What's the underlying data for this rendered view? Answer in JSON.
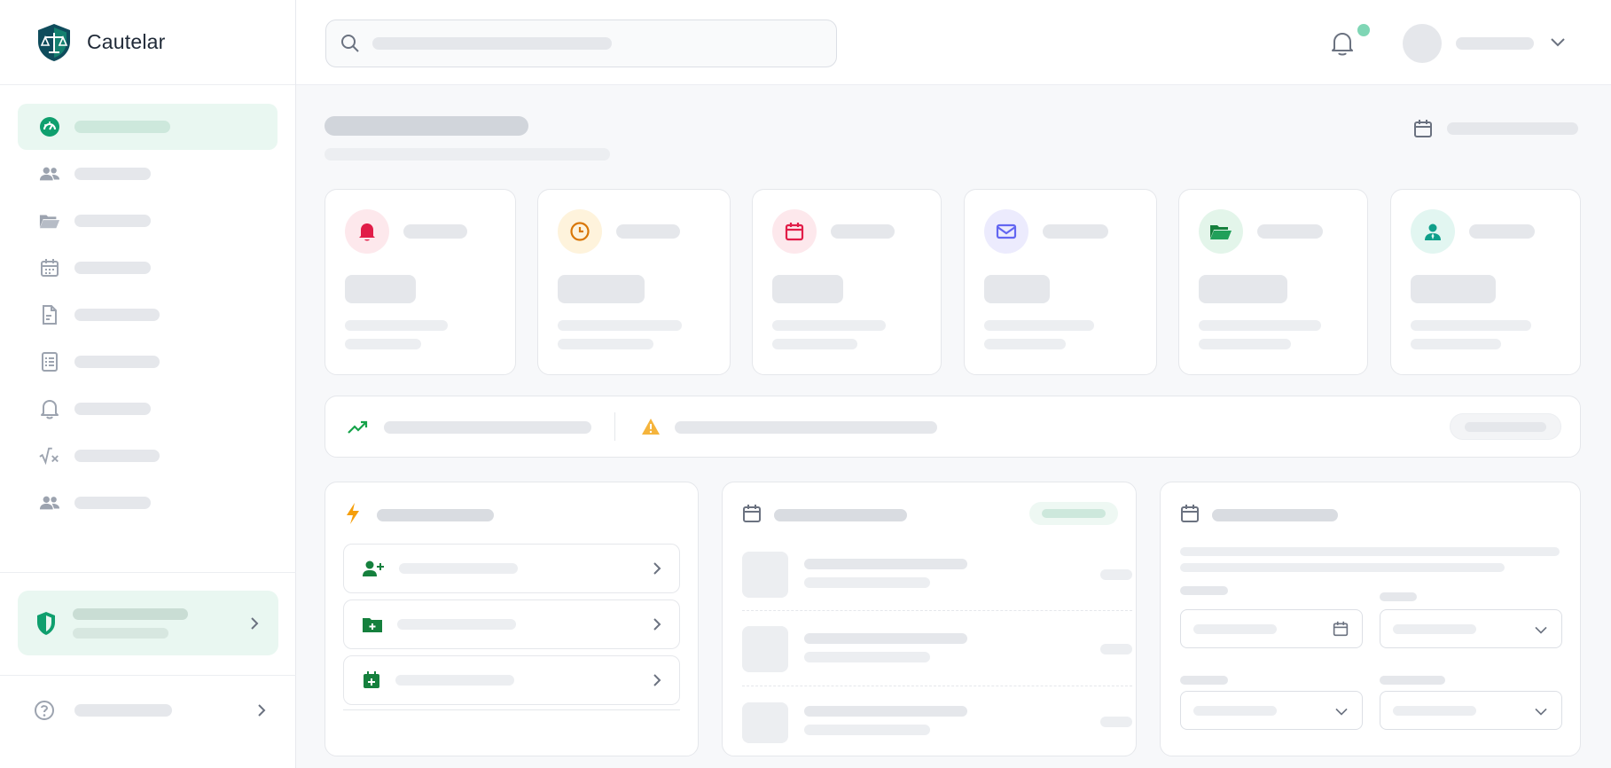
{
  "app": {
    "name": "Cautelar"
  },
  "colors": {
    "brand_green": "#16a34a",
    "active_bg": "#e9f7f1",
    "notification_dot": "#7fd6b5",
    "card_red_bg": "#fde8ec",
    "card_orange_bg": "#fef3dc",
    "card_purple_bg": "#ecebfd",
    "card_green_bg": "#e3f5ea",
    "card_teal_bg": "#e2f6f1"
  },
  "sidebar": {
    "items": [
      {
        "icon": "dashboard-gauge-icon",
        "active": true
      },
      {
        "icon": "users-icon"
      },
      {
        "icon": "folder-open-icon"
      },
      {
        "icon": "calendar-icon"
      },
      {
        "icon": "document-icon"
      },
      {
        "icon": "spreadsheet-icon"
      },
      {
        "icon": "bell-icon"
      },
      {
        "icon": "calculator-formula-icon"
      },
      {
        "icon": "team-icon"
      }
    ],
    "security_icon": "shield-icon",
    "help_icon": "help-circle-icon"
  },
  "topbar": {
    "search_icon": "search-icon",
    "notifications_icon": "bell-icon",
    "user_menu_icon": "chevron-down-icon"
  },
  "stats": [
    {
      "icon": "bell-icon",
      "color": "#e11d48"
    },
    {
      "icon": "clock-icon",
      "color": "#d97706"
    },
    {
      "icon": "calendar-icon",
      "color": "#e11d48"
    },
    {
      "icon": "mail-icon",
      "color": "#6366f1"
    },
    {
      "icon": "folder-open-icon",
      "color": "#15803d"
    },
    {
      "icon": "user-tie-icon",
      "color": "#0f9f8a"
    }
  ],
  "insight": {
    "trend_icon": "trending-up-icon",
    "warning_icon": "warning-icon"
  },
  "quick_actions": {
    "header_icon": "lightning-icon",
    "items": [
      {
        "icon": "user-plus-icon"
      },
      {
        "icon": "folder-plus-icon"
      },
      {
        "icon": "calendar-plus-icon"
      }
    ]
  },
  "appointments": {
    "header_icon": "calendar-icon",
    "count": 3
  },
  "deadline_calc": {
    "header_icon": "calendar-icon"
  }
}
